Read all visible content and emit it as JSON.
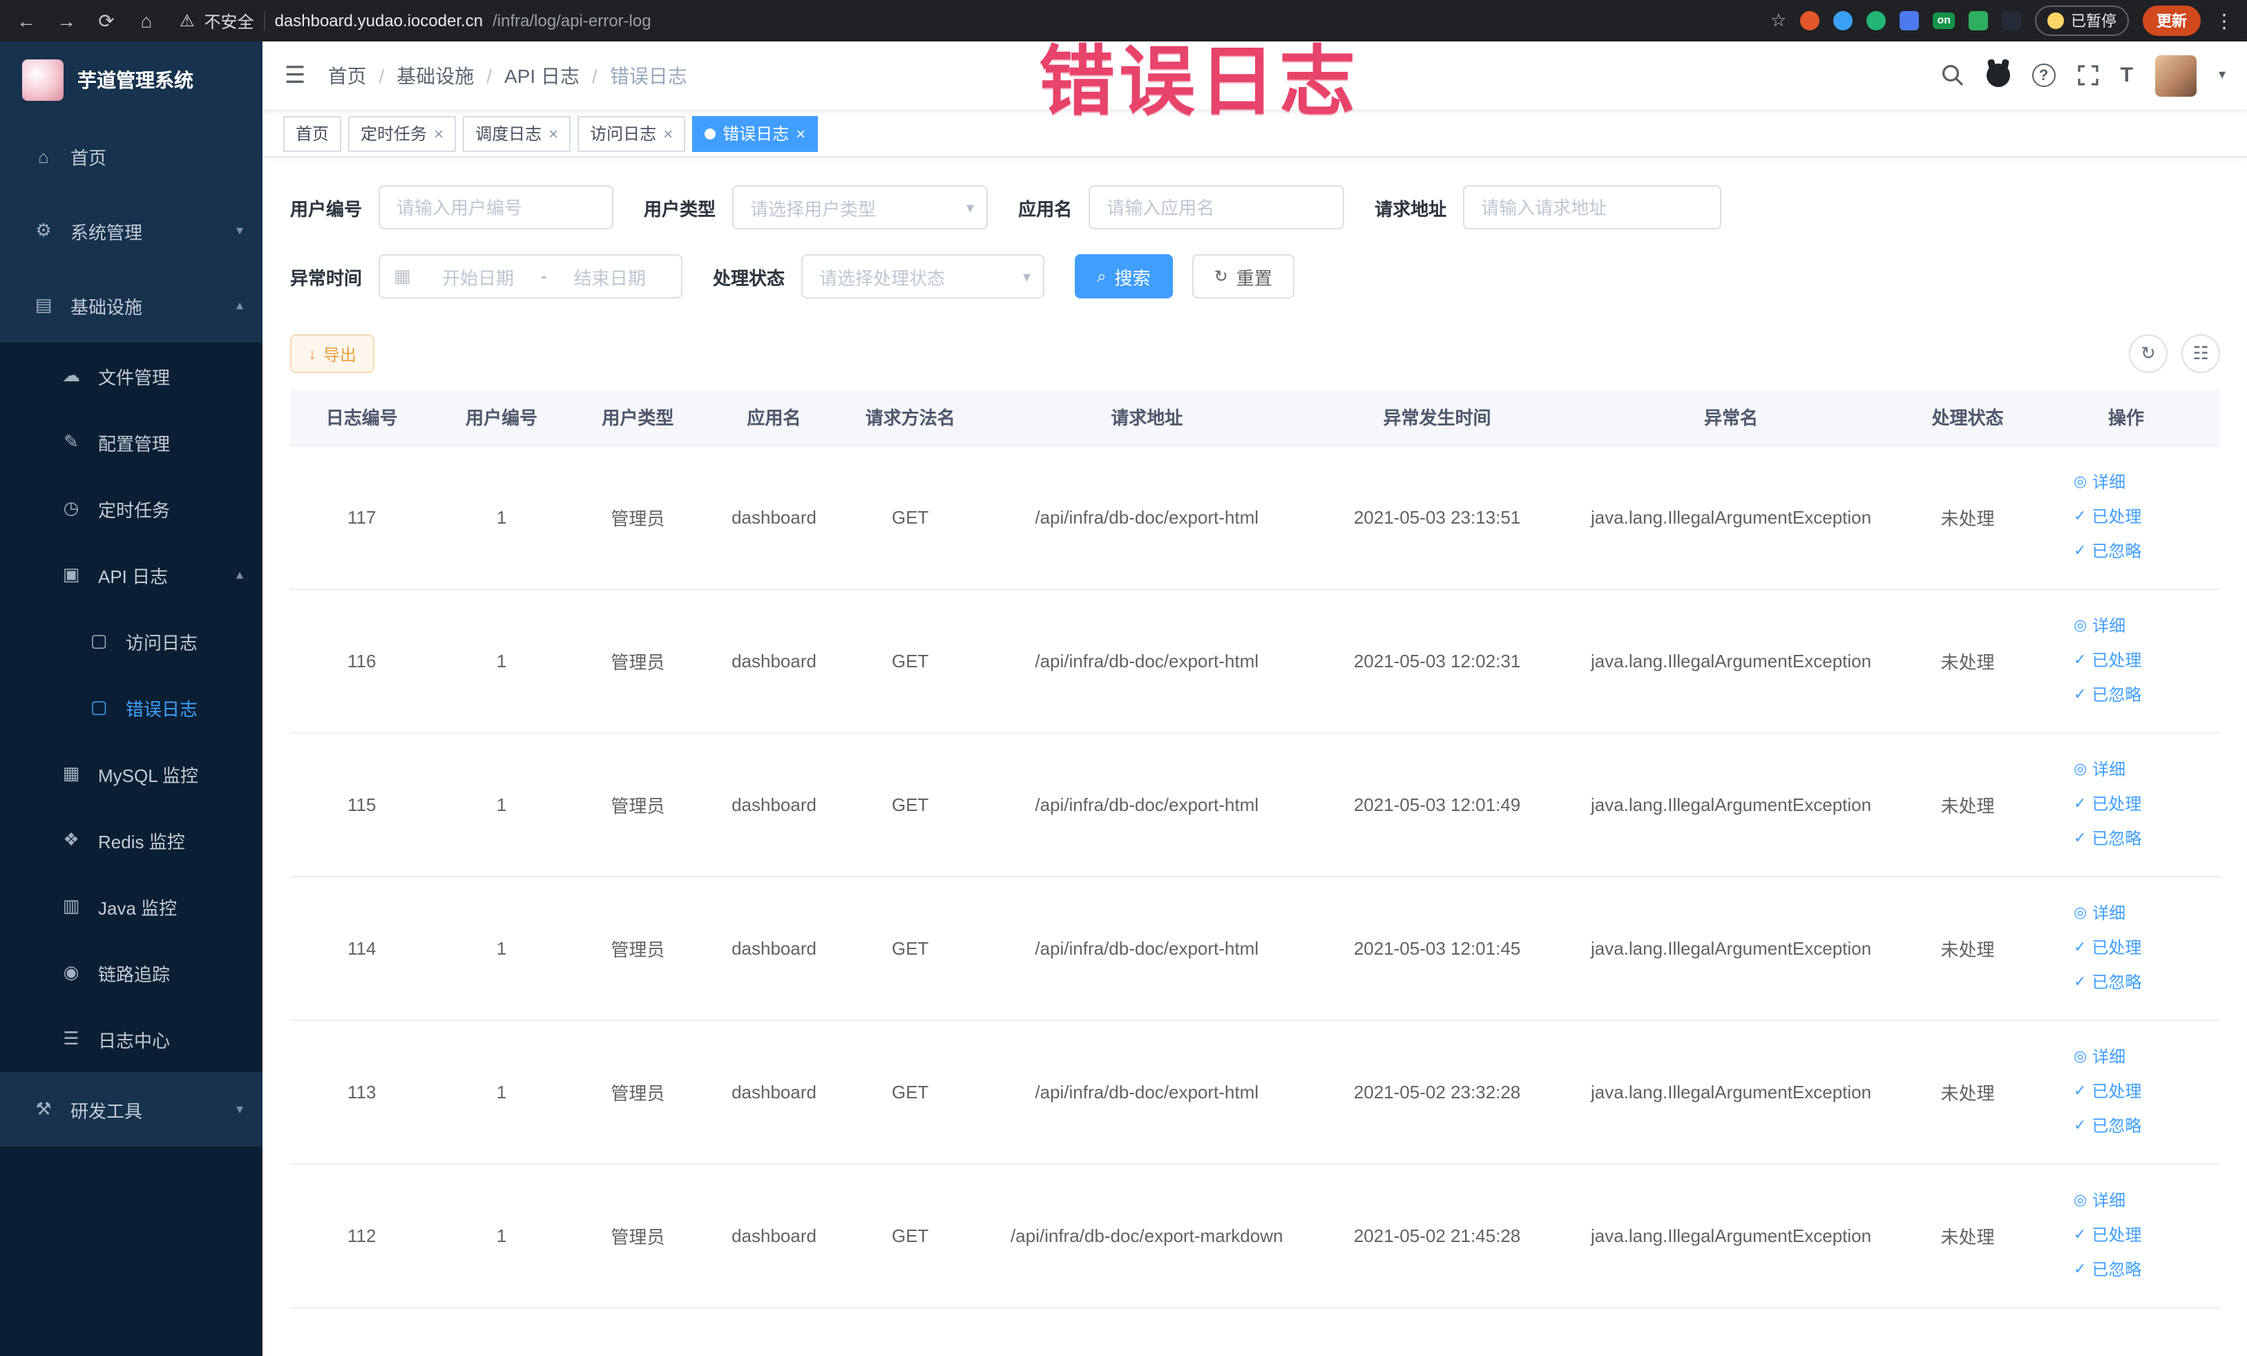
{
  "colors": {
    "accent": "#409EFF",
    "warning": "#e6a23c",
    "watermark": "#e8436a",
    "sidebar_bg": "#0a1f33",
    "sidebar_item_bg": "#16324d"
  },
  "watermark": {
    "text": "错误日志"
  },
  "browser": {
    "security_text": "不安全",
    "url_host": "dashboard.yudao.iocoder.cn",
    "url_path": "/infra/log/api-error-log",
    "on_badge": "on",
    "paused_badge": "已暂停",
    "update_button": "更新"
  },
  "icons": {
    "back": "←",
    "forward": "→",
    "reload": "⟳",
    "home": "⌂",
    "warning": "⚠",
    "star": "☆",
    "menu_dots": "⋮",
    "hamburger": "☰",
    "help": "?",
    "font_size": "T",
    "caret_down": "▾",
    "arrow_up": "▴",
    "arrow_down": "▾",
    "close": "×",
    "calendar": "▦",
    "range_sep": "-",
    "search": "⌕",
    "refresh": "↻",
    "settings_grid": "☷",
    "export": "↓",
    "detail": "◎",
    "check": "✓"
  },
  "sidebar": {
    "logo_title": "芋道管理系统",
    "items": [
      {
        "label": "首页",
        "glyph": "⌂"
      },
      {
        "label": "系统管理",
        "glyph": "⚙"
      },
      {
        "label": "基础设施",
        "glyph": "▤"
      },
      {
        "label": "文件管理",
        "glyph": "☁"
      },
      {
        "label": "配置管理",
        "glyph": "✎"
      },
      {
        "label": "定时任务",
        "glyph": "◷"
      },
      {
        "label": "API 日志",
        "glyph": "▣"
      },
      {
        "label": "访问日志",
        "glyph": "▢"
      },
      {
        "label": "错误日志",
        "glyph": "▢"
      },
      {
        "label": "MySQL 监控",
        "glyph": "▦"
      },
      {
        "label": "Redis 监控",
        "glyph": "❖"
      },
      {
        "label": "Java 监控",
        "glyph": "▥"
      },
      {
        "label": "链路追踪",
        "glyph": "◉"
      },
      {
        "label": "日志中心",
        "glyph": "☰"
      },
      {
        "label": "研发工具",
        "glyph": "⚒"
      }
    ]
  },
  "breadcrumb": {
    "separator": "/",
    "items": [
      "首页",
      "基础设施",
      "API 日志",
      "错误日志"
    ]
  },
  "tabs": [
    {
      "label": "首页"
    },
    {
      "label": "定时任务"
    },
    {
      "label": "调度日志"
    },
    {
      "label": "访问日志"
    },
    {
      "label": "错误日志"
    }
  ],
  "filters": {
    "user_id_label": "用户编号",
    "user_id_placeholder": "请输入用户编号",
    "user_type_label": "用户类型",
    "user_type_placeholder": "请选择用户类型",
    "app_name_label": "应用名",
    "app_name_placeholder": "请输入应用名",
    "request_url_label": "请求地址",
    "request_url_placeholder": "请输入请求地址",
    "time_label": "异常时间",
    "time_start_placeholder": "开始日期",
    "time_end_placeholder": "结束日期",
    "status_label": "处理状态",
    "status_placeholder": "请选择处理状态",
    "search_button": "搜索",
    "reset_button": "重置"
  },
  "toolbar": {
    "export_button": "导出"
  },
  "table": {
    "columns": [
      "日志编号",
      "用户编号",
      "用户类型",
      "应用名",
      "请求方法名",
      "请求地址",
      "异常发生时间",
      "异常名",
      "处理状态",
      "操作"
    ],
    "actions": [
      "详细",
      "已处理",
      "已忽略"
    ],
    "rows": [
      {
        "log_id": "117",
        "user_id": "1",
        "user_type": "管理员",
        "app": "dashboard",
        "method": "GET",
        "url": "/api/infra/db-doc/export-html",
        "time": "2021-05-03 23:13:51",
        "exception": "java.lang.IllegalArgumentException",
        "status": "未处理"
      },
      {
        "log_id": "116",
        "user_id": "1",
        "user_type": "管理员",
        "app": "dashboard",
        "method": "GET",
        "url": "/api/infra/db-doc/export-html",
        "time": "2021-05-03 12:02:31",
        "exception": "java.lang.IllegalArgumentException",
        "status": "未处理"
      },
      {
        "log_id": "115",
        "user_id": "1",
        "user_type": "管理员",
        "app": "dashboard",
        "method": "GET",
        "url": "/api/infra/db-doc/export-html",
        "time": "2021-05-03 12:01:49",
        "exception": "java.lang.IllegalArgumentException",
        "status": "未处理"
      },
      {
        "log_id": "114",
        "user_id": "1",
        "user_type": "管理员",
        "app": "dashboard",
        "method": "GET",
        "url": "/api/infra/db-doc/export-html",
        "time": "2021-05-03 12:01:45",
        "exception": "java.lang.IllegalArgumentException",
        "status": "未处理"
      },
      {
        "log_id": "113",
        "user_id": "1",
        "user_type": "管理员",
        "app": "dashboard",
        "method": "GET",
        "url": "/api/infra/db-doc/export-html",
        "time": "2021-05-02 23:32:28",
        "exception": "java.lang.IllegalArgumentException",
        "status": "未处理"
      },
      {
        "log_id": "112",
        "user_id": "1",
        "user_type": "管理员",
        "app": "dashboard",
        "method": "GET",
        "url": "/api/infra/db-doc/export-markdown",
        "time": "2021-05-02 21:45:28",
        "exception": "java.lang.IllegalArgumentException",
        "status": "未处理"
      }
    ]
  }
}
